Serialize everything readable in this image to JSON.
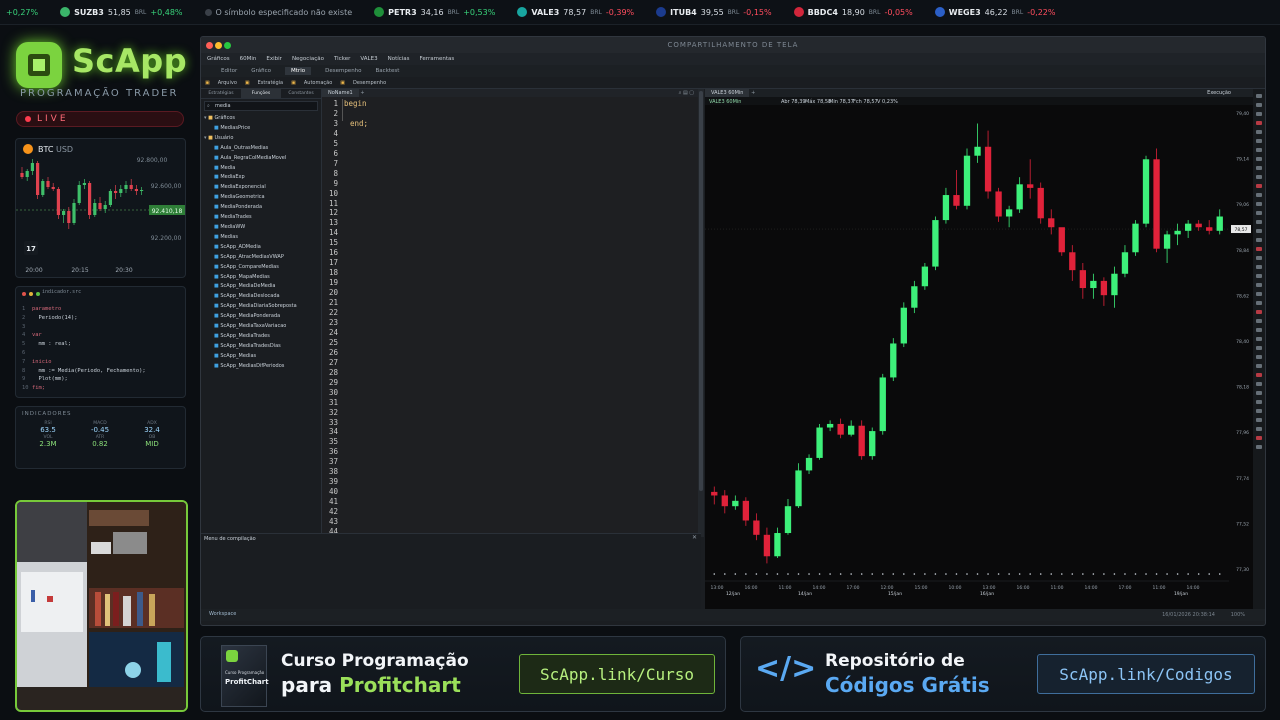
{
  "ticker": [
    {
      "sym": "",
      "price": "",
      "change": "+0,27%",
      "dir": "pos",
      "color": "#0d1116"
    },
    {
      "sym": "SUZB3",
      "price": "51,85",
      "cur": "BRL",
      "change": "+0,48%",
      "dir": "pos",
      "color": "#3bb56a"
    },
    {
      "sym": "",
      "price": "O símbolo especificado não existe",
      "cur": "",
      "change": "",
      "dir": "neu",
      "color": "#555"
    },
    {
      "sym": "PETR3",
      "price": "34,16",
      "cur": "BRL",
      "change": "+0,53%",
      "dir": "pos",
      "color": "#1f8f3a"
    },
    {
      "sym": "VALE3",
      "price": "78,57",
      "cur": "BRL",
      "change": "-0,39%",
      "dir": "neg",
      "color": "#18a6a0"
    },
    {
      "sym": "ITUB4",
      "price": "39,55",
      "cur": "BRL",
      "change": "-0,15%",
      "dir": "neg",
      "color": "#1b3b8e"
    },
    {
      "sym": "BBDC4",
      "price": "18,90",
      "cur": "BRL",
      "change": "-0,05%",
      "dir": "neg",
      "color": "#d1263b"
    },
    {
      "sym": "WEGE3",
      "price": "46,22",
      "cur": "BRL",
      "change": "-0,22%",
      "dir": "neg",
      "color": "#2b5fc7"
    }
  ],
  "brand": {
    "name": "ScApp",
    "subtitle": "PROGRAMAÇÃO TRADER",
    "live": "LIVE"
  },
  "btc": {
    "title": "BTC",
    "pair": "USD",
    "ticks": [
      "92.600,00",
      "92.410,18",
      "92.200,00"
    ],
    "highlight": "92.410,18",
    "prev": "92.800,00",
    "times": [
      "20:00",
      "20:15",
      "20:30"
    ]
  },
  "mini_code": {
    "filename": "indicador.src",
    "lines": [
      "parametro",
      "  Periodo(14);",
      "",
      "var",
      "  mm : real;",
      "",
      "inicio",
      "  mm := Media(Periodo, Fechamento);",
      "  Plot(mm);",
      "fim;"
    ]
  },
  "indicators": {
    "title": "INDICADORES",
    "items": [
      {
        "label": "RSI",
        "value": "63.5",
        "color": "#9fd8ff"
      },
      {
        "label": "MACD",
        "value": "-0.45",
        "color": "#9fd8ff"
      },
      {
        "label": "ADX",
        "value": "32.4",
        "color": "#9fd8ff"
      },
      {
        "label": "VOL",
        "value": "2.3M",
        "color": "#8ce07a"
      },
      {
        "label": "ATR",
        "value": "0.82",
        "color": "#8ce07a"
      },
      {
        "label": "OB",
        "value": "MID",
        "color": "#8ce07a"
      }
    ]
  },
  "window": {
    "title": "COMPARTILHAMENTO DE TELA",
    "menu": [
      "Gráficos",
      "60Min",
      "Exibir",
      "Negociação",
      "Ticker",
      "VALE3",
      "Notícias",
      "Ferramentas"
    ],
    "tabs": [
      "Editor",
      "Gráfico",
      "Mtrio",
      "Desempenho",
      "Backtest"
    ],
    "toolbar": [
      "Arquivo",
      "Estratégia",
      "Automação",
      "Desempenho"
    ],
    "tree_tabs": [
      "Estratégias",
      "Funções",
      "Constantes"
    ],
    "search": "media",
    "tree_groups": [
      "Gráficos",
      "Usuário"
    ],
    "tree_first": "MediasPrice",
    "tree_items": [
      "Aula_OutrasMedias",
      "Aula_RegraColMediaMovel",
      "Media",
      "MediaExp",
      "MediaExponencial",
      "MediaGeometrica",
      "MediaPonderada",
      "MediaTrades",
      "MediaWW",
      "Medias",
      "ScApp_ADMedia",
      "ScApp_AtracMediasVWAP",
      "ScApp_CompareMedias",
      "ScApp_MapaMedias",
      "ScApp_MediaDeMedia",
      "ScApp_MediaDeslocada",
      "ScApp_MediaDiariaSobreposta",
      "ScApp_MediaPonderada",
      "ScApp_MediaTaxaVariacao",
      "ScApp_MediaTrades",
      "ScApp_MediaTradesDias",
      "ScApp_Medias",
      "ScApp_MediasDifPeriodos"
    ],
    "editor_tab": "NoName1",
    "code": [
      "begin",
      "",
      "end;"
    ],
    "line_count": 44,
    "compile_label": "Menu de compilação",
    "workspace": "Workspace",
    "status_right": "16/01/2026 20:38:14",
    "status_conn": "5.5.5.165",
    "zoom": "100%",
    "chart_tab": "VALE3 60Min",
    "execution": "Execução"
  },
  "chart_data": {
    "type": "candlestick",
    "symbol": "VALE3 60Min",
    "ohlc_text": {
      "abe": "Abr 78,39",
      "max": "Máx 78,58",
      "min": "Min 78,37",
      "fch": "Fch 78,57",
      "var": "V 0,23%"
    },
    "y_ticks": [
      "79,40",
      "79,14",
      "79,06",
      "78,84",
      "78,62",
      "78,40",
      "78,18",
      "77,96",
      "77,74",
      "77,52",
      "77,30"
    ],
    "ylim": [
      77.1,
      79.65
    ],
    "last_price": "78,57",
    "x_ticks": [
      "13:00",
      "16:00",
      "11:00",
      "14:00",
      "17:00",
      "12:00",
      "15:00",
      "10:00",
      "13:00",
      "16:00",
      "11:00",
      "14:00",
      "17:00",
      "11:00",
      "14:00"
    ],
    "date_labels": [
      "12/jan",
      "14/jan",
      "14/jan",
      "15/jan",
      "16/jan",
      "19/jan"
    ],
    "candles": [
      [
        77.52,
        77.55,
        77.45,
        77.5
      ],
      [
        77.5,
        77.53,
        77.4,
        77.44
      ],
      [
        77.44,
        77.5,
        77.42,
        77.47
      ],
      [
        77.47,
        77.49,
        77.33,
        77.36
      ],
      [
        77.36,
        77.4,
        77.25,
        77.28
      ],
      [
        77.28,
        77.32,
        77.12,
        77.16
      ],
      [
        77.16,
        77.32,
        77.15,
        77.29
      ],
      [
        77.29,
        77.48,
        77.28,
        77.44
      ],
      [
        77.44,
        77.68,
        77.43,
        77.64
      ],
      [
        77.64,
        77.73,
        77.62,
        77.71
      ],
      [
        77.71,
        77.9,
        77.7,
        77.88
      ],
      [
        77.88,
        77.92,
        77.86,
        77.9
      ],
      [
        77.9,
        77.93,
        77.82,
        77.84
      ],
      [
        77.84,
        77.92,
        77.83,
        77.89
      ],
      [
        77.89,
        77.92,
        77.7,
        77.72
      ],
      [
        77.72,
        77.88,
        77.7,
        77.86
      ],
      [
        77.86,
        78.18,
        77.84,
        78.16
      ],
      [
        78.16,
        78.38,
        78.14,
        78.35
      ],
      [
        78.35,
        78.58,
        78.33,
        78.55
      ],
      [
        78.55,
        78.7,
        78.52,
        78.67
      ],
      [
        78.67,
        78.8,
        78.65,
        78.78
      ],
      [
        78.78,
        79.06,
        78.76,
        79.04
      ],
      [
        79.04,
        79.22,
        79.02,
        79.18
      ],
      [
        79.18,
        79.32,
        79.1,
        79.12
      ],
      [
        79.12,
        79.44,
        79.1,
        79.4
      ],
      [
        79.4,
        79.58,
        79.36,
        79.45
      ],
      [
        79.45,
        79.54,
        79.16,
        79.2
      ],
      [
        79.2,
        79.22,
        79.03,
        79.06
      ],
      [
        79.06,
        79.12,
        79.0,
        79.1
      ],
      [
        79.1,
        79.28,
        79.08,
        79.24
      ],
      [
        79.24,
        79.38,
        79.16,
        79.22
      ],
      [
        79.22,
        79.25,
        79.02,
        79.05
      ],
      [
        79.05,
        79.1,
        78.96,
        79.0
      ],
      [
        79.0,
        78.96,
        78.84,
        78.86
      ],
      [
        78.86,
        78.9,
        78.7,
        78.76
      ],
      [
        78.76,
        78.8,
        78.6,
        78.66
      ],
      [
        78.66,
        78.74,
        78.6,
        78.7
      ],
      [
        78.7,
        78.72,
        78.56,
        78.62
      ],
      [
        78.62,
        78.78,
        78.55,
        78.74
      ],
      [
        78.74,
        78.9,
        78.72,
        78.86
      ],
      [
        78.86,
        79.04,
        78.84,
        79.02
      ],
      [
        79.02,
        79.4,
        79.0,
        79.38
      ],
      [
        79.38,
        79.44,
        78.86,
        78.88
      ],
      [
        78.88,
        78.98,
        78.8,
        78.96
      ],
      [
        78.96,
        79.02,
        78.9,
        78.98
      ],
      [
        78.98,
        79.04,
        78.94,
        79.02
      ],
      [
        79.02,
        79.04,
        78.98,
        79.0
      ],
      [
        79.0,
        79.04,
        78.96,
        78.98
      ],
      [
        78.98,
        79.1,
        78.96,
        79.06
      ]
    ]
  },
  "banner1": {
    "line1": "Curso Programação",
    "line2a": "para ",
    "line2b": "Profitchart",
    "link": "ScApp.link/Curso",
    "box_title": "Curso Programação",
    "box_brand": "ProfitChart"
  },
  "banner2": {
    "line1": "Repositório de",
    "line2": "Códigos Grátis",
    "link": "ScApp.link/Codigos"
  }
}
